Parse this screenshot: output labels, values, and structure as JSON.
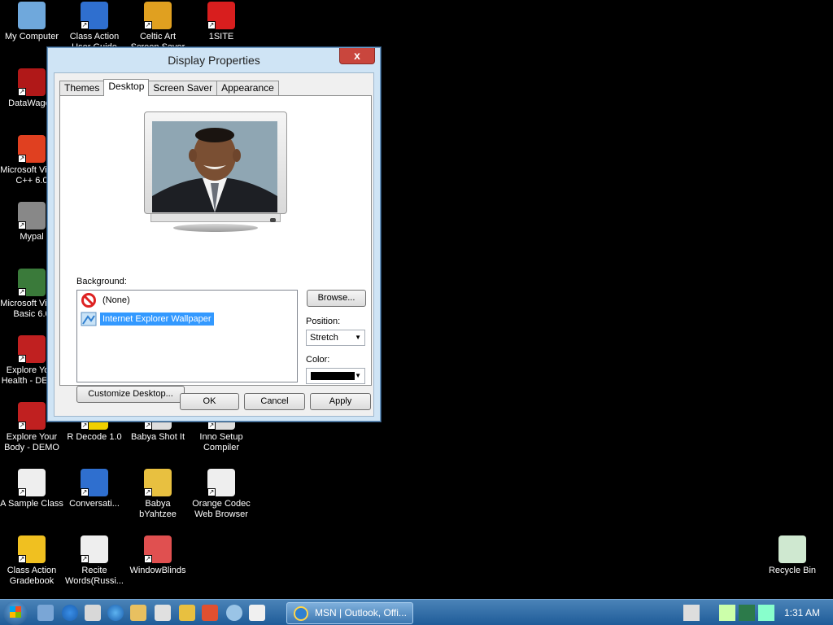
{
  "desktop": {
    "icons": [
      {
        "label": "My Computer",
        "icon": "my-computer-icon",
        "color": "#6fa8dc"
      },
      {
        "label": "Class Action User Guide",
        "icon": "help-icon",
        "color": "#2f6fcf"
      },
      {
        "label": "Celtic Art Screen Saver",
        "icon": "windows-flag-icon",
        "color": "#e0a020"
      },
      {
        "label": "1SITE",
        "icon": "1site-icon",
        "color": "#d81e1e"
      },
      {
        "label": "DataWagon",
        "icon": "datawagon-icon",
        "color": "#b01818"
      },
      {
        "label": "Microsoft Visual C++ 6.0",
        "icon": "visual-cpp-icon",
        "color": "#e04020"
      },
      {
        "label": "Mypal",
        "icon": "mypal-icon",
        "color": "#888888"
      },
      {
        "label": "Microsoft Visual Basic 6.0",
        "icon": "visual-basic-icon",
        "color": "#3a7a3a"
      },
      {
        "label": "Explore Your Health - DEMO",
        "icon": "explore-health-icon",
        "color": "#c02020"
      },
      {
        "label": "Explore Your Body - DEMO",
        "icon": "explore-body-icon",
        "color": "#c02020"
      },
      {
        "label": "R Decode 1.0",
        "icon": "rdecode-icon",
        "color": "#f0d000"
      },
      {
        "label": "Babya Shot It",
        "icon": "babya-shot-icon",
        "color": "#dddddd"
      },
      {
        "label": "Inno Setup Compiler",
        "icon": "inno-setup-icon",
        "color": "#dddddd"
      },
      {
        "label": "A Sample Class",
        "icon": "sample-class-icon",
        "color": "#eeeeee"
      },
      {
        "label": "Conversati...",
        "icon": "conversation-icon",
        "color": "#2f6fcf"
      },
      {
        "label": "Babya bYahtzee",
        "icon": "babya-yahtzee-icon",
        "color": "#e8c040"
      },
      {
        "label": "Orange Codec Web Browser",
        "icon": "orange-codec-icon",
        "color": "#eeeeee"
      },
      {
        "label": "Class Action Gradebook",
        "icon": "gradebook-icon",
        "color": "#f0c020"
      },
      {
        "label": "Recite Words(Russi...",
        "icon": "recite-words-icon",
        "color": "#eeeeee"
      },
      {
        "label": "WindowBlinds",
        "icon": "windowblinds-icon",
        "color": "#e05050"
      },
      {
        "label": "Recycle Bin",
        "icon": "recycle-bin-icon",
        "color": "#cfe8d0"
      }
    ]
  },
  "dialog": {
    "title": "Display Properties",
    "close_label": "x",
    "tabs": [
      "Themes",
      "Desktop",
      "Screen Saver",
      "Appearance"
    ],
    "active_tab": "Desktop",
    "background_label": "Background:",
    "background_items": [
      {
        "label": "(None)",
        "icon": "none-icon"
      },
      {
        "label": "Internet Explorer Wallpaper",
        "icon": "wallpaper-icon",
        "selected": true
      }
    ],
    "browse_label": "Browse...",
    "position_label": "Position:",
    "position_value": "Stretch",
    "color_label": "Color:",
    "color_value": "#000000",
    "customize_label": "Customize Desktop...",
    "ok_label": "OK",
    "cancel_label": "Cancel",
    "apply_label": "Apply"
  },
  "taskbar": {
    "task_label": "MSN | Outlook, Offi...",
    "clock": "1:31 AM"
  }
}
